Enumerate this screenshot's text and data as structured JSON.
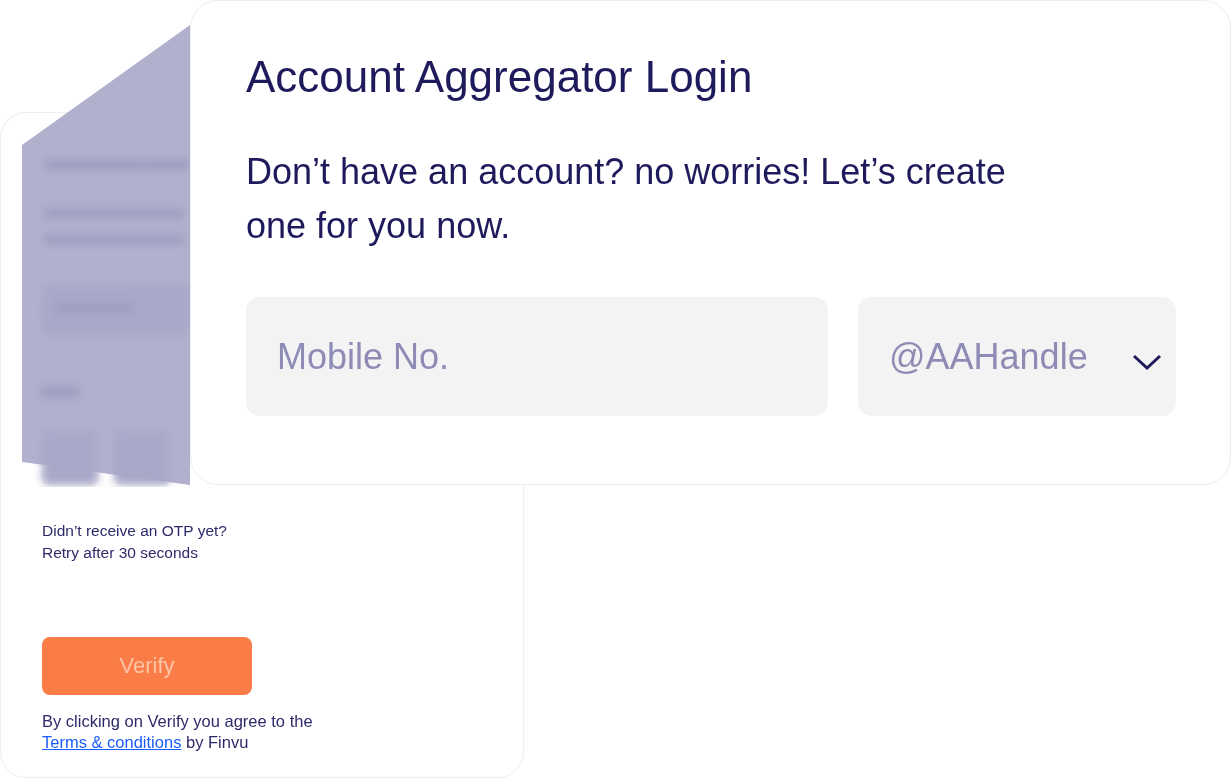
{
  "login_card": {
    "title": "Account Aggregator Login",
    "subtitle": "Don’t have an account? no worries! Let’s create one for you now.",
    "mobile_field": {
      "placeholder": "Mobile No."
    },
    "handle_field": {
      "placeholder": "@AAHandle"
    }
  },
  "otp_card": {
    "resend_lines": [
      "Didn’t receive an OTP yet?",
      "Retry after 30 seconds"
    ],
    "verify_button": {
      "label": "Verify",
      "disabled": true
    },
    "terms": {
      "prefix": "By clicking on Verify you agree to the",
      "link": "Terms & conditions",
      "suffix": "by Finvu"
    }
  }
}
